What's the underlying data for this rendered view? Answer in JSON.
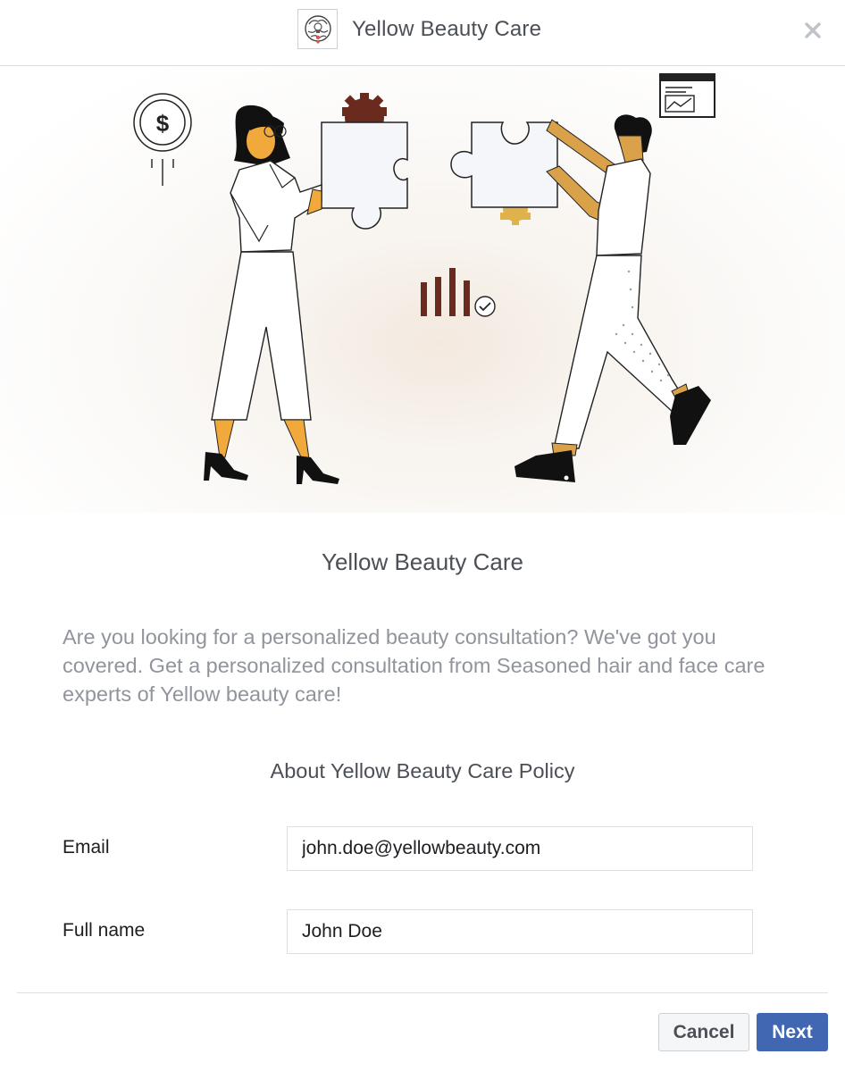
{
  "header": {
    "brand_name": "Yellow Beauty Care",
    "logo_icon": "brain-lightbulb-logo-icon",
    "close_icon": "close-icon"
  },
  "hero": {
    "illustration": "two-people-fitting-puzzle-pieces",
    "icons": [
      "dollar-coin-icon",
      "gear-icon",
      "bar-chart-check-icon",
      "browser-chart-icon"
    ],
    "colors": {
      "accent_orange": "#f2a93b",
      "accent_brown": "#6b2a1e",
      "accent_gold": "#e0b24b"
    }
  },
  "main": {
    "title": "Yellow Beauty Care",
    "description": "Are you looking for a personalized beauty consultation? We've got you covered. Get a personalized consultation from Seasoned hair and face care experts of Yellow beauty care!",
    "policy_link": "About Yellow Beauty Care Policy"
  },
  "form": {
    "email_label": "Email",
    "email_value": "john.doe@yellowbeauty.com",
    "fullname_label": "Full name",
    "fullname_value": "John Doe"
  },
  "footer": {
    "cancel_label": "Cancel",
    "next_label": "Next",
    "primary_color": "#4267b2"
  }
}
